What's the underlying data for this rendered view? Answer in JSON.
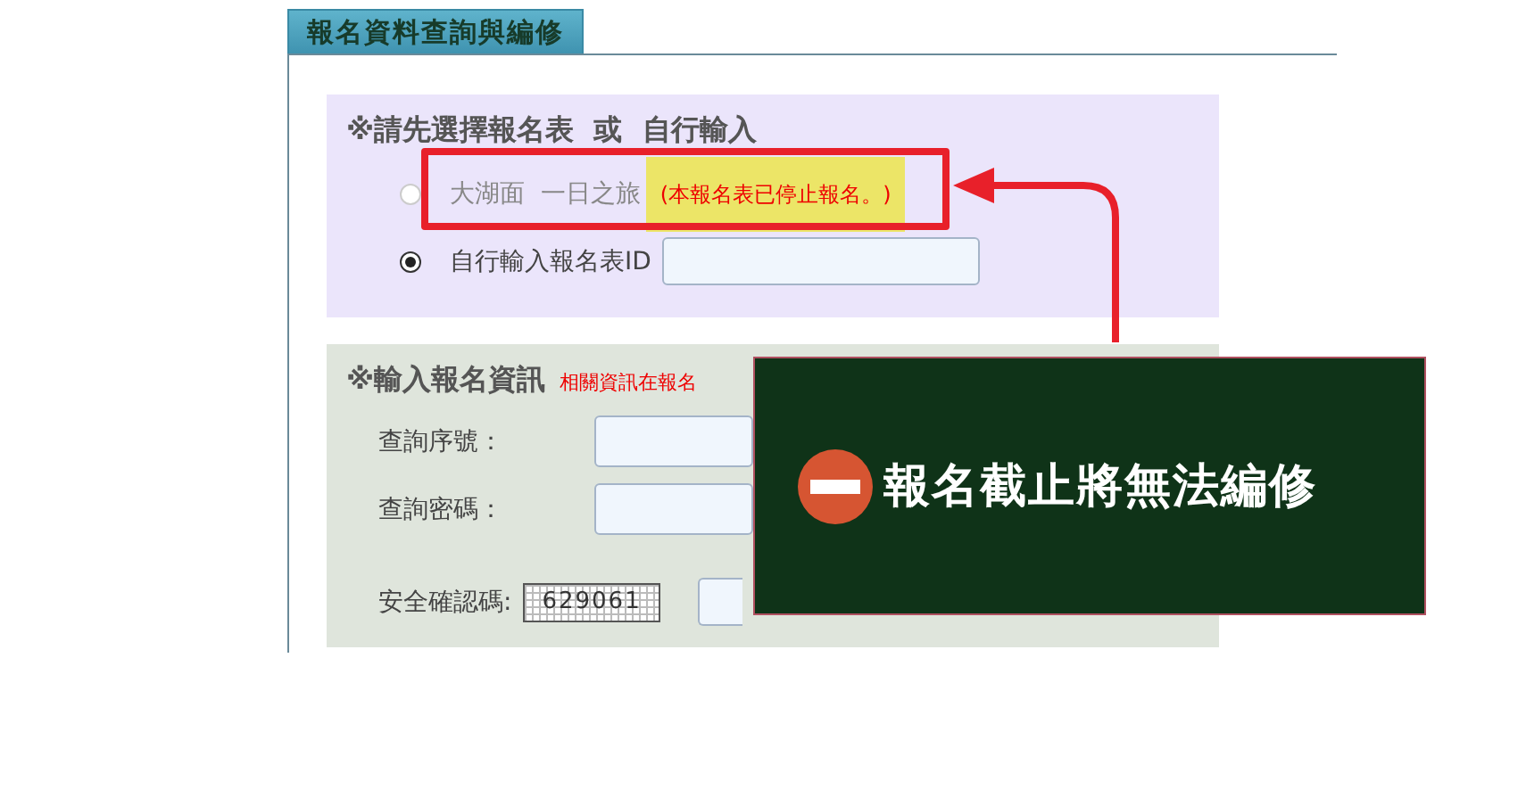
{
  "panel": {
    "title": "報名資料查詢與編修"
  },
  "form_select": {
    "heading": "※請先選擇報名表  或  自行輸入",
    "options": [
      {
        "kind": "form",
        "label": "大湖面  一日之旅",
        "note": "(本報名表已停止報名。)",
        "selected": false,
        "disabled": true
      },
      {
        "kind": "id_input",
        "label": "自行輸入報名表ID",
        "selected": true,
        "disabled": false
      }
    ]
  },
  "info": {
    "heading": "※輸入報名資訊",
    "note": "相關資訊在報名",
    "fields": [
      {
        "label": "查詢序號："
      },
      {
        "label": "查詢密碼："
      }
    ],
    "captcha": {
      "label": "安全確認碼:",
      "code": "629061"
    }
  },
  "callout": {
    "text": "報名截止將無法編修"
  }
}
